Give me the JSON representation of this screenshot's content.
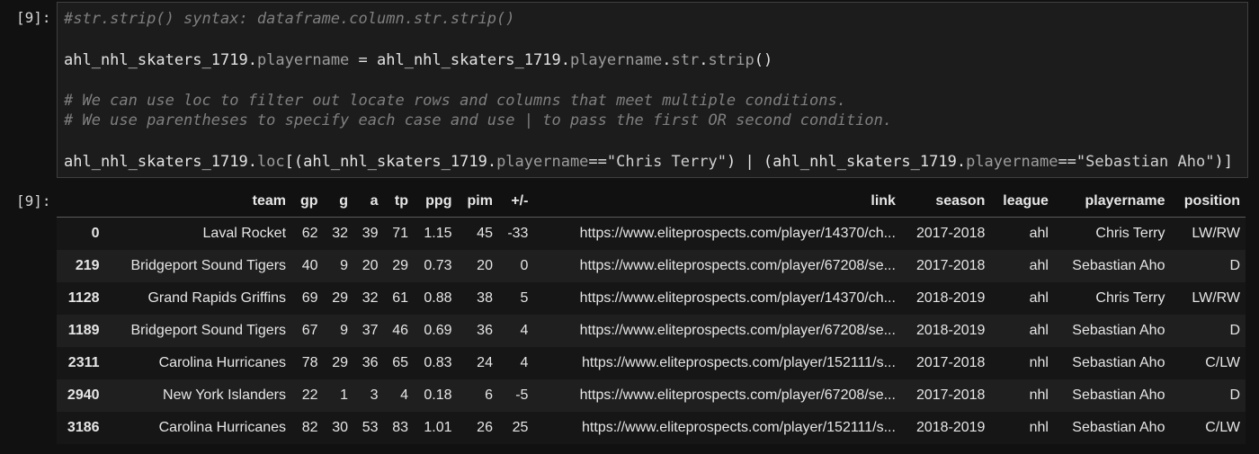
{
  "input_prompt": "[9]:",
  "output_prompt": "[9]:",
  "code_lines": {
    "l1": "#str.strip() syntax: dataframe.column.str.strip()",
    "l2_a": "ahl_nhl_skaters_1719.",
    "l2_b": "playername",
    "l2_c": " = ahl_nhl_skaters_1719.",
    "l2_d": "playername",
    "l2_e": ".",
    "l2_f": "str",
    "l2_g": ".",
    "l2_h": "strip",
    "l2_i": "()",
    "l3": "# We can use loc to filter out locate rows and columns that meet multiple conditions.",
    "l4": "# We use parentheses to specify each case and use | to pass the first OR second condition.",
    "l5_a": "ahl_nhl_skaters_1719.",
    "l5_b": "loc",
    "l5_c": "[(ahl_nhl_skaters_1719.",
    "l5_d": "playername",
    "l5_e": "==",
    "l5_f": "\"Chris Terry\"",
    "l5_g": ") | (ahl_nhl_skaters_1719.",
    "l5_h": "playername",
    "l5_i": "==",
    "l5_j": "\"Sebastian Aho\"",
    "l5_k": ")]"
  },
  "table": {
    "columns": [
      "team",
      "gp",
      "g",
      "a",
      "tp",
      "ppg",
      "pim",
      "+/-",
      "link",
      "season",
      "league",
      "playername",
      "position"
    ],
    "rows": [
      {
        "index": "0",
        "cells": [
          "Laval Rocket",
          "62",
          "32",
          "39",
          "71",
          "1.15",
          "45",
          "-33",
          "https://www.eliteprospects.com/player/14370/ch...",
          "2017-2018",
          "ahl",
          "Chris Terry",
          "LW/RW"
        ]
      },
      {
        "index": "219",
        "cells": [
          "Bridgeport Sound Tigers",
          "40",
          "9",
          "20",
          "29",
          "0.73",
          "20",
          "0",
          "https://www.eliteprospects.com/player/67208/se...",
          "2017-2018",
          "ahl",
          "Sebastian Aho",
          "D"
        ]
      },
      {
        "index": "1128",
        "cells": [
          "Grand Rapids Griffins",
          "69",
          "29",
          "32",
          "61",
          "0.88",
          "38",
          "5",
          "https://www.eliteprospects.com/player/14370/ch...",
          "2018-2019",
          "ahl",
          "Chris Terry",
          "LW/RW"
        ]
      },
      {
        "index": "1189",
        "cells": [
          "Bridgeport Sound Tigers",
          "67",
          "9",
          "37",
          "46",
          "0.69",
          "36",
          "4",
          "https://www.eliteprospects.com/player/67208/se...",
          "2018-2019",
          "ahl",
          "Sebastian Aho",
          "D"
        ]
      },
      {
        "index": "2311",
        "cells": [
          "Carolina Hurricanes",
          "78",
          "29",
          "36",
          "65",
          "0.83",
          "24",
          "4",
          "https://www.eliteprospects.com/player/152111/s...",
          "2017-2018",
          "nhl",
          "Sebastian Aho",
          "C/LW"
        ]
      },
      {
        "index": "2940",
        "cells": [
          "New York Islanders",
          "22",
          "1",
          "3",
          "4",
          "0.18",
          "6",
          "-5",
          "https://www.eliteprospects.com/player/67208/se...",
          "2017-2018",
          "nhl",
          "Sebastian Aho",
          "D"
        ]
      },
      {
        "index": "3186",
        "cells": [
          "Carolina Hurricanes",
          "82",
          "30",
          "53",
          "83",
          "1.01",
          "26",
          "25",
          "https://www.eliteprospects.com/player/152111/s...",
          "2018-2019",
          "nhl",
          "Sebastian Aho",
          "C/LW"
        ]
      }
    ]
  }
}
